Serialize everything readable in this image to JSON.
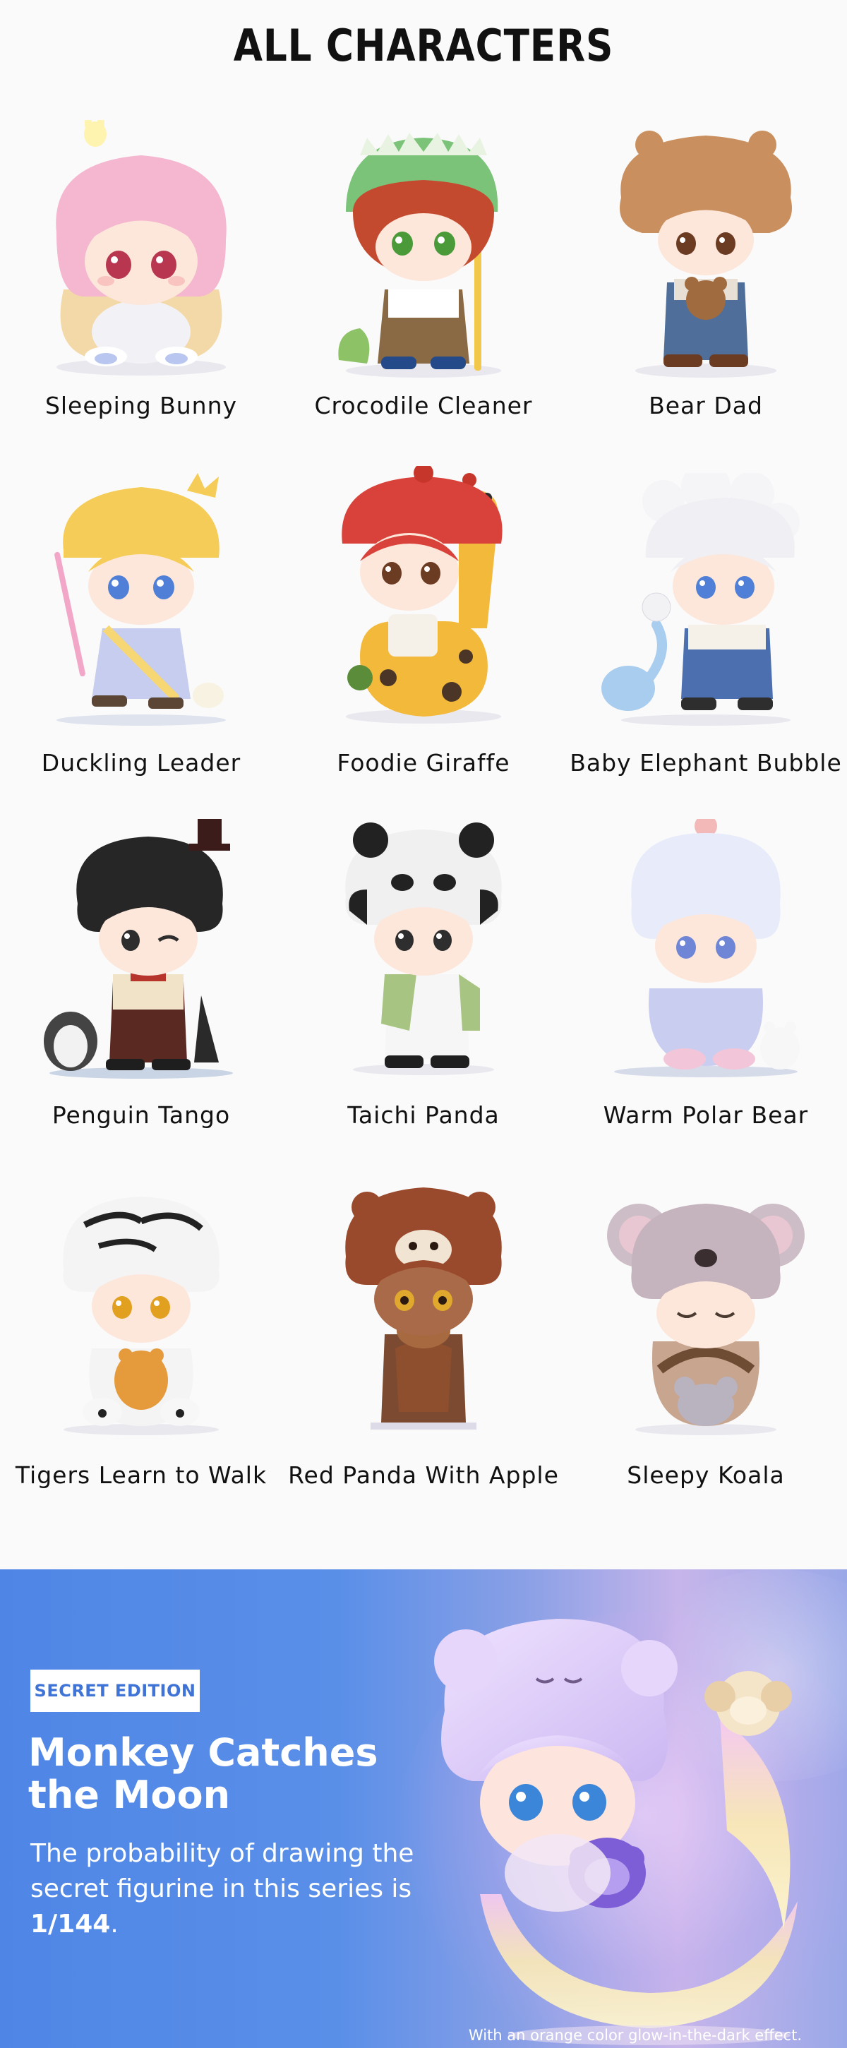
{
  "title": "ALL CHARACTERS",
  "characters": [
    {
      "name": "Sleeping Bunny",
      "icon": "sleeping-bunny-figure"
    },
    {
      "name": "Crocodile Cleaner",
      "icon": "crocodile-cleaner-figure"
    },
    {
      "name": "Bear Dad",
      "icon": "bear-dad-figure"
    },
    {
      "name": "Duckling Leader",
      "icon": "duckling-leader-figure"
    },
    {
      "name": "Foodie Giraffe",
      "icon": "foodie-giraffe-figure"
    },
    {
      "name": "Baby Elephant Bubble",
      "icon": "baby-elephant-bubble-figure"
    },
    {
      "name": "Penguin Tango",
      "icon": "penguin-tango-figure"
    },
    {
      "name": "Taichi Panda",
      "icon": "taichi-panda-figure"
    },
    {
      "name": "Warm Polar Bear",
      "icon": "warm-polar-bear-figure"
    },
    {
      "name": "Tigers Learn to Walk",
      "icon": "tigers-learn-to-walk-figure"
    },
    {
      "name": "Red Panda With Apple",
      "icon": "red-panda-with-apple-figure"
    },
    {
      "name": "Sleepy Koala",
      "icon": "sleepy-koala-figure"
    }
  ],
  "secret": {
    "badge": "SECRET EDITION",
    "title": "Monkey Catches the Moon",
    "desc_prefix": "The probability of drawing the secret figurine in this series is ",
    "probability": "1/144",
    "desc_suffix": ".",
    "note": "With an orange color glow-in-the-dark effect.",
    "icon": "monkey-catches-the-moon-figure"
  },
  "colors": {
    "background": "#fafafa",
    "title_text": "#111111",
    "secret_blue": "#4f86e6",
    "badge_text": "#3f73d6"
  }
}
